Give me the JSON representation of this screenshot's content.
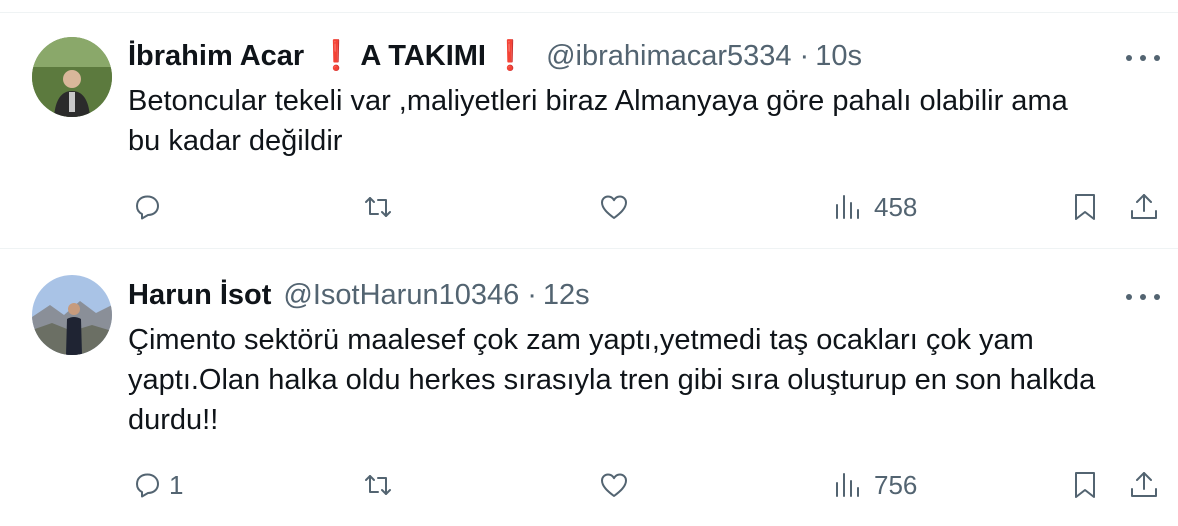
{
  "tweets": [
    {
      "name": "İbrahim Acar",
      "badge_mark": "❗",
      "badge_text": "A TAKIMI",
      "badge_mark_end": "❗",
      "handle": "@ibrahimacar5334",
      "separator": "·",
      "time": "10s",
      "text_line1": "Betoncular tekeli var ,maliyetleri biraz Almanyaya göre pahalı olabilir ama",
      "text_line2": "bu kadar değildir",
      "reply_count": "",
      "views": "458"
    },
    {
      "name": "Harun İsot",
      "handle": "@IsotHarun10346",
      "separator": "·",
      "time": "12s",
      "text_line1": "Çimento sektörü maalesef çok zam yaptı,yetmedi taş ocakları çok yam",
      "text_line2": "yaptı.Olan halka oldu herkes sırasıyla tren gibi sıra oluşturup en son halkda",
      "text_line3": "durdu!!",
      "reply_count": "1",
      "views": "756"
    }
  ],
  "icons": {
    "reply": "reply-icon",
    "retweet": "retweet-icon",
    "like": "heart-icon",
    "views": "views-icon",
    "bookmark": "bookmark-icon",
    "share": "share-icon",
    "more": "more-icon"
  },
  "colors": {
    "text": "#0f1419",
    "muted": "#536471",
    "divider": "#eff3f4",
    "badge_red": "#e0203a"
  }
}
